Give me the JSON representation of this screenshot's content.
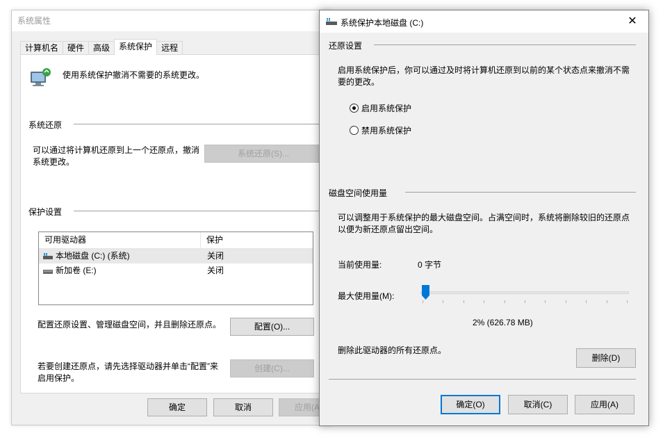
{
  "background_window": {
    "title": "系统属性",
    "tabs": [
      "计算机名",
      "硬件",
      "高级",
      "系统保护",
      "远程"
    ],
    "active_tab": 3,
    "intro": "使用系统保护撤消不需要的系统更改。",
    "restore_group": "系统还原",
    "restore_text_1": "可以通过将计算机还原到上一个还原点，撤消",
    "restore_text_2": "系统更改。",
    "restore_button": "系统还原(S)...",
    "protection_group": "保护设置",
    "drive_table": {
      "headers": [
        "可用驱动器",
        "保护"
      ],
      "rows": [
        {
          "drive": "本地磁盘 (C:) (系统)",
          "protection": "关闭",
          "selected": true,
          "icon": "system-drive-icon"
        },
        {
          "drive": "新加卷 (E:)",
          "protection": "关闭",
          "selected": false,
          "icon": "drive-icon"
        }
      ]
    },
    "configure_text": "配置还原设置、管理磁盘空间，并且删除还原点。",
    "configure_button": "配置(O)...",
    "create_text_1": "若要创建还原点，请先选择驱动器并单击“配置”来",
    "create_text_2": "启用保护。",
    "create_button": "创建(C)...",
    "ok_button": "确定",
    "cancel_button": "取消",
    "apply_button": "应用(A)"
  },
  "dialog": {
    "title": "系统保护本地磁盘 (C:)",
    "restore_settings_group": "还原设置",
    "restore_desc_1": "启用系统保护后，你可以通过及时将计算机还原到以前的某个状态点来撤消不需",
    "restore_desc_2": "要的更改。",
    "radio_enable": "启用系统保护",
    "radio_disable": "禁用系统保护",
    "selected_radio": "enable",
    "disk_usage_group": "磁盘空间使用量",
    "usage_desc_1": "可以调整用于系统保护的最大磁盘空间。占满空间时，系统将删除较旧的还原点",
    "usage_desc_2": "以便为新还原点留出空间。",
    "current_usage_label": "当前使用量:",
    "current_usage_value": "0 字节",
    "max_usage_label": "最大使用量(M):",
    "slider_percent": 2,
    "max_usage_value": "2% (626.78 MB)",
    "delete_text": "删除此驱动器的所有还原点。",
    "delete_button": "删除(D)",
    "ok_button": "确定(O)",
    "cancel_button": "取消(C)",
    "apply_button": "应用(A)"
  }
}
